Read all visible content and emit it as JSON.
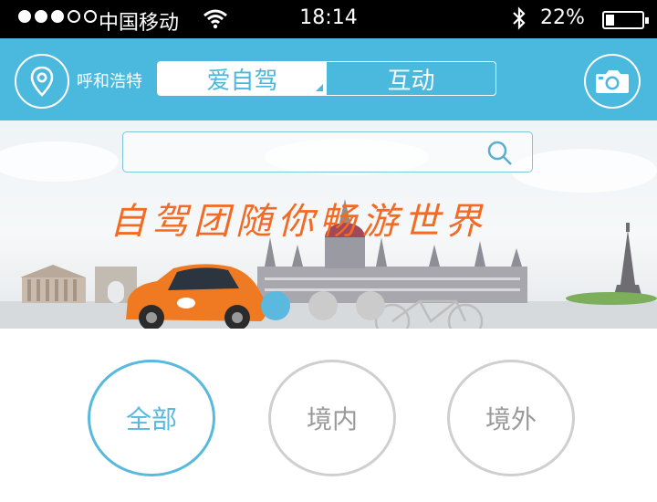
{
  "status_bar": {
    "carrier": "中国移动",
    "time": "18:14",
    "battery_percent": "22%",
    "signal_bars_filled": 3,
    "signal_bars_total": 5
  },
  "header": {
    "city": "呼和浩特",
    "tabs": [
      {
        "label": "爱自驾",
        "active": true
      },
      {
        "label": "互动",
        "active": false
      }
    ],
    "location_icon": "location-pin-icon",
    "camera_icon": "camera-icon"
  },
  "banner": {
    "search": {
      "placeholder": "",
      "value": ""
    },
    "slogan": "自驾团随你畅游世界",
    "slides_total": 3,
    "active_slide": 0
  },
  "categories": [
    {
      "label": "全部",
      "active": true
    },
    {
      "label": "境内",
      "active": false
    },
    {
      "label": "境外",
      "active": false
    }
  ],
  "colors": {
    "brand": "#4bb8dd",
    "slogan": "#f26a23",
    "inactive_ring": "#cfcfcf",
    "car": "#f07a22"
  }
}
